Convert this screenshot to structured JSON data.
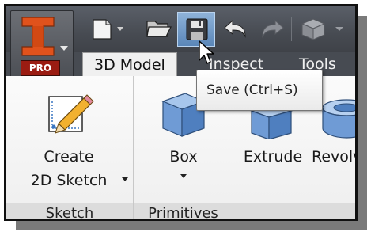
{
  "app": {
    "edition_badge": "PRO",
    "logo_icon": "inventor-logo-icon"
  },
  "quick_access": {
    "items": [
      {
        "name": "new-document-icon"
      },
      {
        "name": "open-folder-icon"
      },
      {
        "name": "save-icon"
      },
      {
        "name": "undo-icon"
      },
      {
        "name": "redo-icon"
      },
      {
        "name": "appearance-icon"
      }
    ]
  },
  "tabs": [
    "3D Model",
    "Inspect",
    "Tools"
  ],
  "panels": {
    "sketch": {
      "title": "Sketch",
      "create_line1": "Create",
      "create_line2": "2D Sketch"
    },
    "primitives": {
      "title": "Primitives",
      "box_label": "Box"
    },
    "create": {
      "extrude_label": "Extrude",
      "revolve_label": "Revolv"
    }
  },
  "tooltip": {
    "text": "Save (Ctrl+S)"
  },
  "colors": {
    "logo_orange": "#e0521c",
    "pro_red": "#9b1c12",
    "hover_blue": "#5a86b8",
    "shape_blue": "#6f9bd5"
  }
}
